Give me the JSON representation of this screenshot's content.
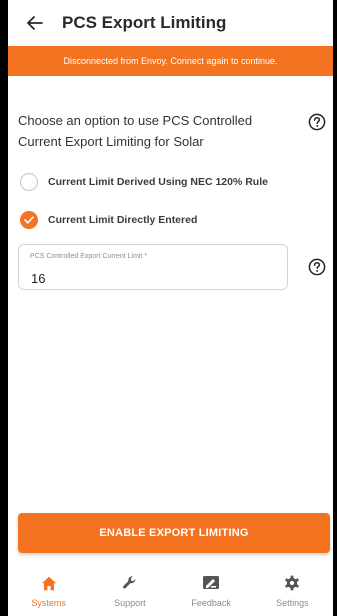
{
  "header": {
    "title": "PCS Export Limiting",
    "back_icon": "back-arrow-icon"
  },
  "banner": {
    "text": "Disconnected from Envoy. Connect again to continue."
  },
  "main": {
    "question": "Choose an option to use PCS Controlled Current Export Limiting for Solar",
    "options": [
      {
        "label": "Current Limit Derived Using NEC 120% Rule",
        "selected": false
      },
      {
        "label": "Current Limit Directly Entered",
        "selected": true
      }
    ],
    "current_limit_field": {
      "label": "PCS Controlled Export Current Limit *",
      "value": "16"
    },
    "action_button": "ENABLE EXPORT LIMITING"
  },
  "tabbar": {
    "tabs": [
      {
        "label": "Systems",
        "icon": "home-icon",
        "active": true
      },
      {
        "label": "Support",
        "icon": "wrench-icon",
        "active": false
      },
      {
        "label": "Feedback",
        "icon": "feedback-icon",
        "active": false
      },
      {
        "label": "Settings",
        "icon": "gear-icon",
        "active": false
      }
    ]
  },
  "colors": {
    "accent": "#f37321",
    "text": "#333333",
    "muted": "#8a8a8a"
  }
}
